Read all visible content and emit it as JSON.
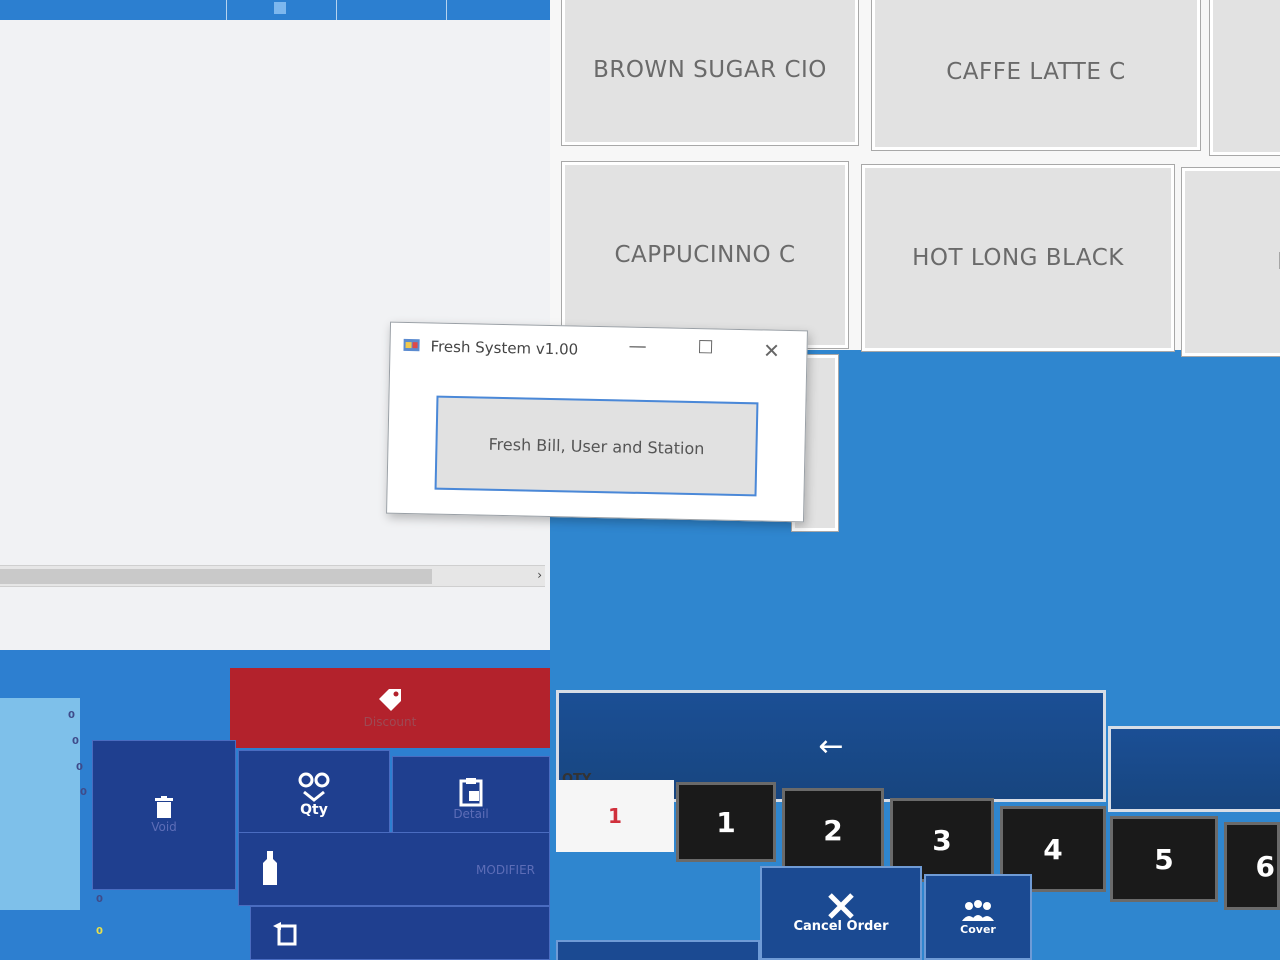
{
  "products": [
    {
      "label": "BROWN SUGAR CIO"
    },
    {
      "label": "CAFFE LATTE C"
    },
    {
      "label": "CAPPUCINNO C"
    },
    {
      "label": "HOT LONG BLACK"
    },
    {
      "label": "H"
    }
  ],
  "dialog": {
    "title": "Fresh System v1.00",
    "button_label": "Fresh Bill, User and Station",
    "minimize_glyph": "—",
    "maximize_glyph": "☐",
    "close_glyph": "✕"
  },
  "left_panel": {
    "zeros": [
      "0",
      "0",
      "0",
      "0",
      "0",
      "0",
      "0"
    ],
    "discount_label": "Discount",
    "void_label": "Void",
    "qty_label": "Qty",
    "detail_label": "Detail",
    "modifier_label": "MODIFIER"
  },
  "numpad": {
    "qty_label": "QTY",
    "qty_value": "1",
    "back_glyph": "←",
    "keys": [
      "1",
      "2",
      "3",
      "4",
      "5",
      "6"
    ]
  },
  "actions": {
    "cancel_order_label": "Cancel Order",
    "cover_label": "Cover"
  },
  "icons": {
    "discount": "discount-tag-icon",
    "void": "trash-icon",
    "qty": "people-qty-icon",
    "detail": "clipboard-icon",
    "modifier": "bottle-icon",
    "transfer": "transfer-icon",
    "cancel": "x-icon",
    "cover": "group-icon"
  }
}
